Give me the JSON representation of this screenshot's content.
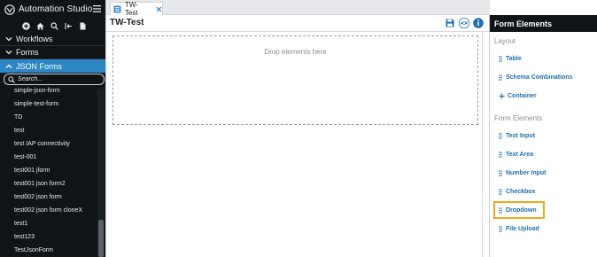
{
  "app": {
    "title": "Automation Studio"
  },
  "sidebar": {
    "sections": [
      {
        "label": "Workflows"
      },
      {
        "label": "Forms"
      },
      {
        "label": "JSON Forms"
      }
    ],
    "search": {
      "placeholder": "Search..."
    },
    "items": [
      "simple-json-form",
      "simple-test-form",
      "TD",
      "test",
      "test IAP connectivity",
      "test-001",
      "test001 jform",
      "test001 json form2",
      "test002 json form",
      "test002 json form cloneX",
      "test1",
      "test123",
      "TestJsonForm"
    ]
  },
  "main": {
    "tab": {
      "label": "TW-Test"
    },
    "title": "TW-Test",
    "dropzone_text": "Drop elements here"
  },
  "panel": {
    "header": "Form Elements",
    "groups": [
      {
        "title": "Layout",
        "items": [
          {
            "label": "Table",
            "icon": "grip"
          },
          {
            "label": "Schema Combinations",
            "icon": "grip"
          },
          {
            "label": "Container",
            "icon": "plus"
          }
        ]
      },
      {
        "title": "Form Elements",
        "items": [
          {
            "label": "Text Input",
            "icon": "grip"
          },
          {
            "label": "Text Area",
            "icon": "grip"
          },
          {
            "label": "Number Input",
            "icon": "grip"
          },
          {
            "label": "Checkbox",
            "icon": "grip"
          },
          {
            "label": "Dropdown",
            "icon": "grip"
          },
          {
            "label": "File Upload",
            "icon": "grip"
          }
        ]
      }
    ]
  },
  "colors": {
    "sidebar_bg": "#111417",
    "accent": "#2d87c4",
    "link": "#1f6fb2",
    "highlight": "#f0a81a"
  }
}
